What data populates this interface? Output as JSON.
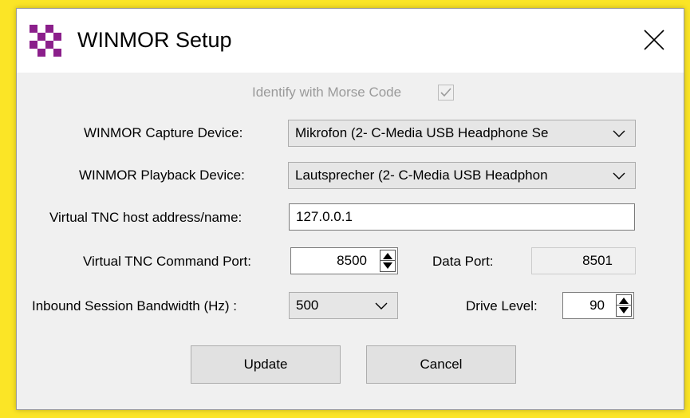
{
  "window": {
    "title": "WINMOR Setup",
    "icon": "checkered-purple-icon",
    "close_icon": "close-icon"
  },
  "morse": {
    "label": "Identify with Morse Code",
    "checked": true
  },
  "capture": {
    "label": "WINMOR Capture Device:",
    "value": "Mikrofon (2- C-Media USB Headphone Se"
  },
  "playback": {
    "label": "WINMOR Playback Device:",
    "value": "Lautsprecher (2- C-Media USB Headphon"
  },
  "host": {
    "label": "Virtual TNC host address/name:",
    "value": "127.0.0.1"
  },
  "command_port": {
    "label": "Virtual TNC Command Port:",
    "value": "8500"
  },
  "data_port": {
    "label": "Data Port:",
    "value": "8501"
  },
  "bandwidth": {
    "label": "Inbound Session Bandwidth (Hz) :",
    "value": "500"
  },
  "drive": {
    "label": "Drive Level:",
    "value": "90"
  },
  "buttons": {
    "update": "Update",
    "cancel": "Cancel"
  },
  "colors": {
    "background": "#fbe526",
    "dialog": "#f0f0f0",
    "icon": "#8b1f8b"
  }
}
